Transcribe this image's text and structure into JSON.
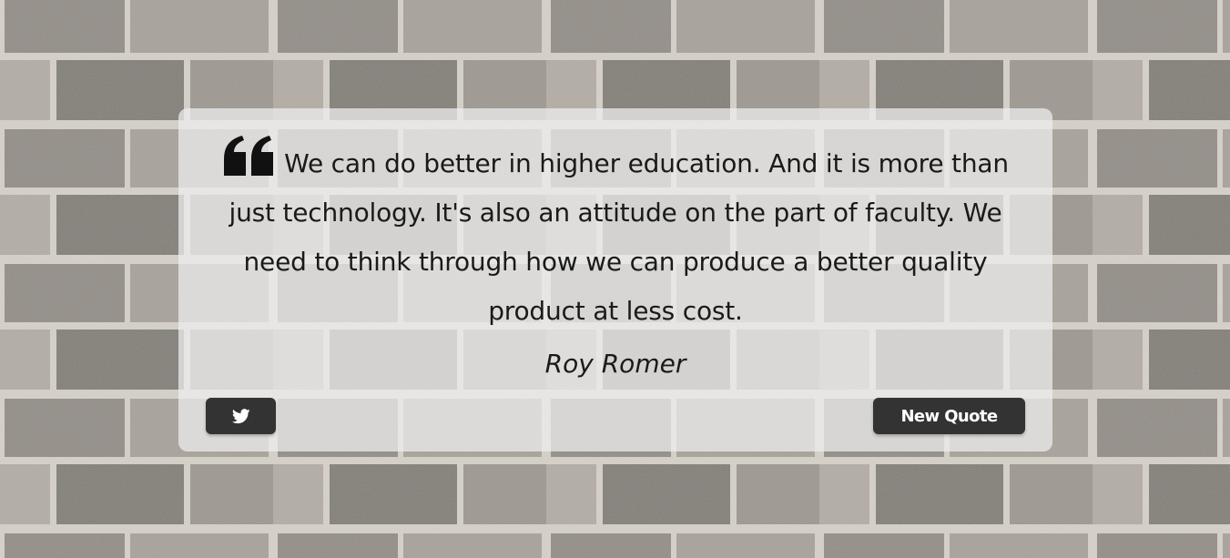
{
  "quote": {
    "text": "We can do better in higher education. And it is more than just technology. It's also an attitude on the part of faculty. We need to think through how we can produce a better quality product at less cost.",
    "author": "Roy Romer"
  },
  "actions": {
    "tweet_icon": "twitter-icon",
    "new_quote_label": "New Quote"
  },
  "colors": {
    "button_bg": "#333333",
    "button_text": "#ffffff",
    "box_bg": "#eeeeee",
    "text": "#1a1a1a"
  }
}
